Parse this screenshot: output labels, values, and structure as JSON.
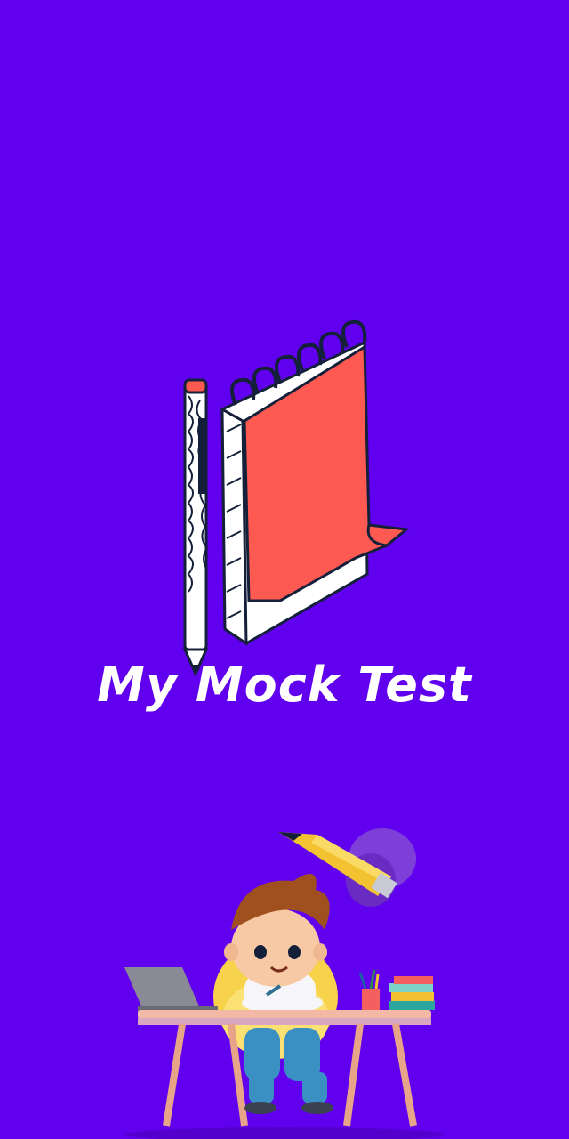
{
  "splash": {
    "app_title": "My Mock Test",
    "logo": "notepad-and-pencil-icon",
    "illustration": "boy-studying-at-desk-with-pencil-rocket"
  },
  "colors": {
    "background": "#6100EE",
    "notepad_red": "#FF5A52",
    "outline": "#14203A",
    "title_text": "#FFFFFF"
  }
}
